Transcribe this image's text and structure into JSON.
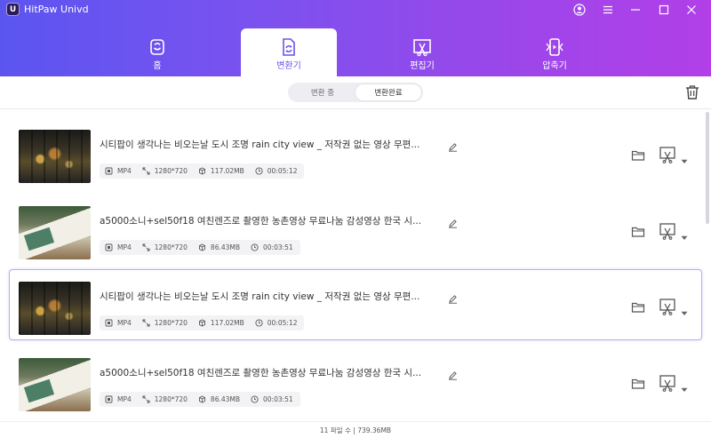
{
  "app": {
    "title": "HitPaw Univd",
    "logo_text": "U"
  },
  "nav": {
    "tabs": [
      {
        "label": "홈",
        "icon": "home-icon",
        "active": false
      },
      {
        "label": "변환기",
        "icon": "converter-icon",
        "active": true
      },
      {
        "label": "편집기",
        "icon": "editor-icon",
        "active": false
      },
      {
        "label": "압축기",
        "icon": "compressor-icon",
        "active": false
      }
    ]
  },
  "toolbar": {
    "segment": {
      "converting_label": "변환 중",
      "completed_label": "변환완료",
      "active": "변환완료"
    }
  },
  "files": [
    {
      "title": "시티팝이 생각나는 비오는날 도시 조명 rain city view _ 저작권 없는 영상 무편...",
      "format": "MP4",
      "resolution": "1280*720",
      "size": "117.02MB",
      "duration": "00:05:12",
      "thumbnail": "city",
      "selected": false
    },
    {
      "title": "a5000소니+sel50f18 여친렌즈로 촬영한 농촌영상 무료나눔 감성영상 한국 시...",
      "format": "MP4",
      "resolution": "1280*720",
      "size": "86.43MB",
      "duration": "00:03:51",
      "thumbnail": "desk",
      "selected": false
    },
    {
      "title": "시티팝이 생각나는 비오는날 도시 조명 rain city view _ 저작권 없는 영상 무편...",
      "format": "MP4",
      "resolution": "1280*720",
      "size": "117.02MB",
      "duration": "00:05:12",
      "thumbnail": "city",
      "selected": true
    },
    {
      "title": "a5000소니+sel50f18 여친렌즈로 촬영한 농촌영상 무료나눔 감성영상 한국 시...",
      "format": "MP4",
      "resolution": "1280*720",
      "size": "86.43MB",
      "duration": "00:03:51",
      "thumbnail": "desk",
      "selected": false
    }
  ],
  "footer": {
    "summary": "11 파일 수 | 739.36MB"
  },
  "colors": {
    "header_gradient_start": "#5b55f0",
    "header_gradient_end": "#b23fe8",
    "accent": "#6a55e8",
    "selected_border": "#b3b0ef"
  }
}
